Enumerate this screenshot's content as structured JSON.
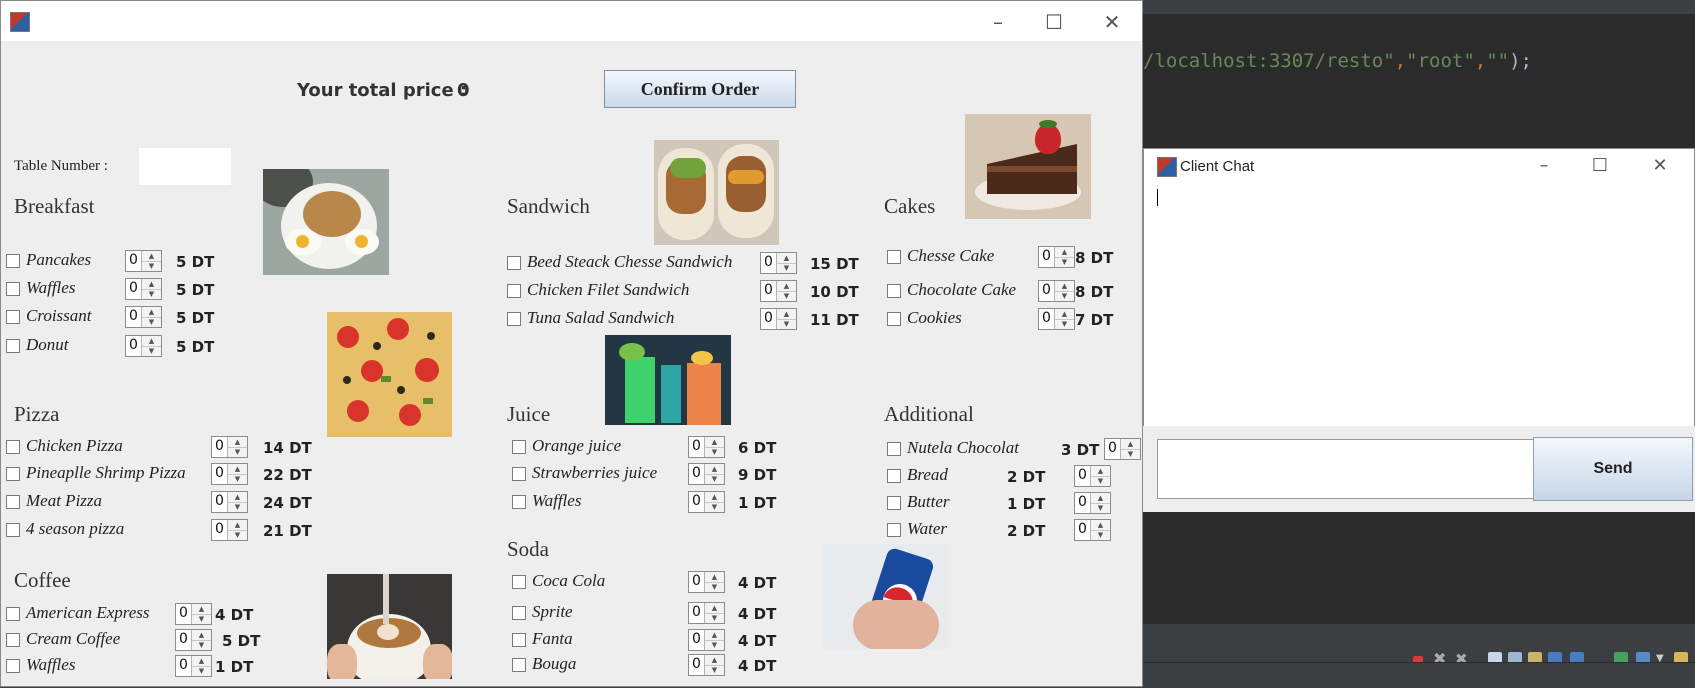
{
  "ide": {
    "code_line": {
      "segment_1": "/localhost:3307/resto\"",
      "segment_2": ",",
      "segment_3": "\"root\"",
      "segment_4": ",",
      "segment_5": "\"\"",
      "segment_6": ");"
    },
    "colors": {
      "string": "#6a8759",
      "punct": "#cc7832",
      "text": "#a9b7c6"
    }
  },
  "main_window": {
    "total_label": "Your total price :",
    "total_value": "0",
    "confirm_button": "Confirm Order",
    "table_number_label": "Table Number :",
    "table_number_value": "",
    "categories": {
      "breakfast": {
        "title": "Breakfast",
        "items": [
          {
            "name": "Pancakes",
            "qty": "0",
            "price": "5 DT"
          },
          {
            "name": "Waffles",
            "qty": "0",
            "price": "5 DT"
          },
          {
            "name": "Croissant",
            "qty": "0",
            "price": "5 DT"
          },
          {
            "name": "Donut",
            "qty": "0",
            "price": "5 DT"
          }
        ]
      },
      "pizza": {
        "title": "Pizza",
        "items": [
          {
            "name": "Chicken Pizza",
            "qty": "0",
            "price": "14 DT"
          },
          {
            "name": "Pineaplle Shrimp Pizza",
            "qty": "0",
            "price": "22 DT"
          },
          {
            "name": "Meat Pizza",
            "qty": "0",
            "price": "24 DT"
          },
          {
            "name": "4 season pizza",
            "qty": "0",
            "price": "21 DT"
          }
        ]
      },
      "coffee": {
        "title": "Coffee",
        "items": [
          {
            "name": "American Express",
            "qty": "0",
            "price": "4 DT"
          },
          {
            "name": "Cream Coffee",
            "qty": "0",
            "price": "5 DT"
          },
          {
            "name": "Waffles",
            "qty": "0",
            "price": "1 DT"
          }
        ]
      },
      "sandwich": {
        "title": "Sandwich",
        "items": [
          {
            "name": "Beed Steack Chesse Sandwich",
            "qty": "0",
            "price": "15 DT"
          },
          {
            "name": "Chicken Filet Sandwich",
            "qty": "0",
            "price": "10 DT"
          },
          {
            "name": "Tuna Salad Sandwich",
            "qty": "0",
            "price": "11 DT"
          }
        ]
      },
      "juice": {
        "title": "Juice",
        "items": [
          {
            "name": "Orange juice",
            "qty": "0",
            "price": "6 DT"
          },
          {
            "name": "Strawberries juice",
            "qty": "0",
            "price": "9 DT"
          },
          {
            "name": "Waffles",
            "qty": "0",
            "price": "1 DT"
          }
        ]
      },
      "soda": {
        "title": "Soda",
        "items": [
          {
            "name": "Coca Cola",
            "qty": "0",
            "price": "4 DT"
          },
          {
            "name": "Sprite",
            "qty": "0",
            "price": "4 DT"
          },
          {
            "name": "Fanta",
            "qty": "0",
            "price": "4 DT"
          },
          {
            "name": "Bouga",
            "qty": "0",
            "price": "4 DT"
          }
        ]
      },
      "cakes": {
        "title": "Cakes",
        "items": [
          {
            "name": "Chesse Cake",
            "qty": "0",
            "price": "8 DT"
          },
          {
            "name": "Chocolate Cake",
            "qty": "0",
            "price": "8 DT"
          },
          {
            "name": "Cookies",
            "qty": "0",
            "price": "7 DT"
          }
        ]
      },
      "additional": {
        "title": "Additional",
        "items": [
          {
            "name": "Nutela Chocolat",
            "qty": "0",
            "price": "3 DT"
          },
          {
            "name": "Bread",
            "qty": "0",
            "price": "2 DT"
          },
          {
            "name": "Butter",
            "qty": "0",
            "price": "1 DT"
          },
          {
            "name": "Water",
            "qty": "0",
            "price": "2 DT"
          }
        ]
      }
    }
  },
  "chat_window": {
    "title": "Client Chat",
    "message_input": "",
    "send_button": "Send"
  },
  "icons": [
    "app-icon",
    "minimize-icon",
    "maximize-icon",
    "close-icon",
    "spinner-up-icon",
    "spinner-down-icon"
  ]
}
